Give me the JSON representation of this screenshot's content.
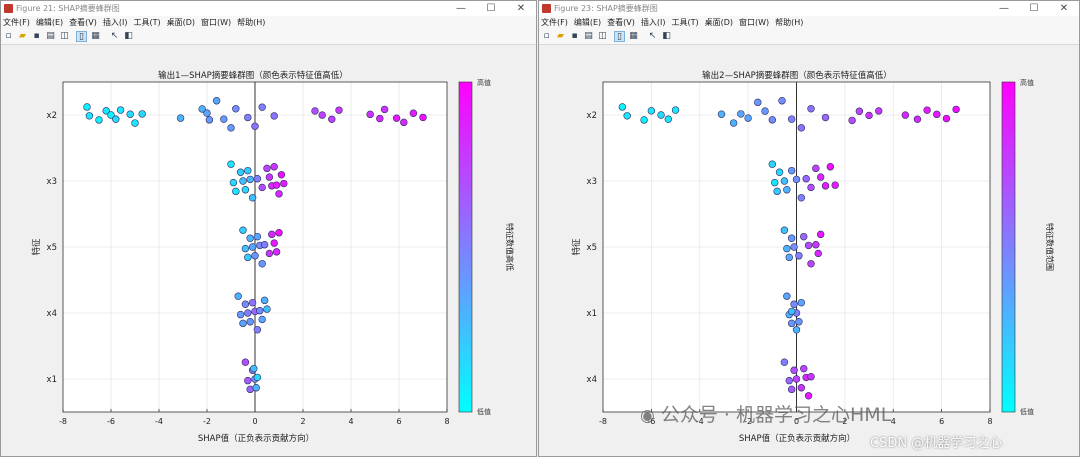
{
  "windows": [
    {
      "title": "Figure 21: SHAP摘要蜂群图",
      "menu": [
        "文件(F)",
        "编辑(E)",
        "查看(V)",
        "插入(I)",
        "工具(T)",
        "桌面(D)",
        "窗口(W)",
        "帮助(H)"
      ],
      "plot": {
        "title": "输出1—SHAP摘要蜂群图（颜色表示特征值高低）",
        "xlabel": "SHAP值（正负表示贡献方向）",
        "ylabel": "特征",
        "colorbar": {
          "top_label": "高值",
          "bottom_label": "低值",
          "label": "特征数值高低"
        }
      }
    },
    {
      "title": "Figure 23: SHAP摘要蜂群图",
      "menu": [
        "文件(F)",
        "编辑(E)",
        "查看(V)",
        "插入(I)",
        "工具(T)",
        "桌面(D)",
        "窗口(W)",
        "帮助(H)"
      ],
      "plot": {
        "title": "输出2—SHAP摘要蜂群图（颜色表示特征值高低）",
        "xlabel": "SHAP值（正负表示贡献方向）",
        "ylabel": "特征",
        "colorbar": {
          "top_label": "高值",
          "bottom_label": "低值",
          "label": "特征数值范围"
        }
      }
    }
  ],
  "toolbar_icons": [
    "new-file-icon",
    "open-folder-icon",
    "save-icon",
    "print-icon",
    "print-preview-icon",
    "link-plot-icon",
    "data-cursor-icon",
    "arrow-icon",
    "panel-icon"
  ],
  "watermark": {
    "wechat": "公众号 · 机器学习之心HML",
    "csdn": "CSDN @机器学习之心"
  },
  "colors": {
    "colormap_low": "#00ffff",
    "colormap_high": "#ff00ff"
  },
  "chart_data": [
    {
      "type": "scatter",
      "subtype": "beeswarm",
      "title": "输出1—SHAP摘要蜂群图（颜色表示特征值高低）",
      "xlabel": "SHAP值（正负表示贡献方向）",
      "ylabel": "特征",
      "xlim": [
        -8,
        8
      ],
      "xticks": [
        -8,
        -6,
        -4,
        -2,
        0,
        2,
        4,
        6,
        8
      ],
      "grid": true,
      "colormap": "cool",
      "features": [
        {
          "name": "x2",
          "points": [
            [
              -7,
              0.05
            ],
            [
              -6.9,
              0.1
            ],
            [
              -6.5,
              0.05
            ],
            [
              -6.2,
              0.1
            ],
            [
              -6,
              0.05
            ],
            [
              -5.8,
              0.15
            ],
            [
              -5.6,
              0.1
            ],
            [
              -5.2,
              0.15
            ],
            [
              -5,
              0.1
            ],
            [
              -4.7,
              0.15
            ],
            [
              -3.1,
              0.3
            ],
            [
              -2.2,
              0.3
            ],
            [
              -2,
              0.35
            ],
            [
              -1.9,
              0.4
            ],
            [
              -1.6,
              0.35
            ],
            [
              -1.3,
              0.4
            ],
            [
              -1,
              0.4
            ],
            [
              -0.8,
              0.45
            ],
            [
              -0.3,
              0.5
            ],
            [
              0,
              0.55
            ],
            [
              0.3,
              0.5
            ],
            [
              0.8,
              0.55
            ],
            [
              2.5,
              0.7
            ],
            [
              2.8,
              0.75
            ],
            [
              3.2,
              0.75
            ],
            [
              3.5,
              0.8
            ],
            [
              4.8,
              0.8
            ],
            [
              5.2,
              0.85
            ],
            [
              5.4,
              0.8
            ],
            [
              5.9,
              0.9
            ],
            [
              6.2,
              0.85
            ],
            [
              6.6,
              0.9
            ],
            [
              7,
              0.95
            ]
          ]
        },
        {
          "name": "x3",
          "points": [
            [
              -1,
              0.1
            ],
            [
              -0.9,
              0.15
            ],
            [
              -0.8,
              0.1
            ],
            [
              -0.6,
              0.2
            ],
            [
              -0.5,
              0.25
            ],
            [
              -0.4,
              0.15
            ],
            [
              -0.3,
              0.2
            ],
            [
              -0.2,
              0.3
            ],
            [
              -0.1,
              0.25
            ],
            [
              0.1,
              0.5
            ],
            [
              0.3,
              0.7
            ],
            [
              0.5,
              0.75
            ],
            [
              0.6,
              0.8
            ],
            [
              0.7,
              0.85
            ],
            [
              0.8,
              0.8
            ],
            [
              0.9,
              0.9
            ],
            [
              1,
              0.85
            ],
            [
              1.1,
              0.95
            ],
            [
              1.2,
              0.9
            ]
          ]
        },
        {
          "name": "x5",
          "points": [
            [
              -0.5,
              0.2
            ],
            [
              -0.4,
              0.25
            ],
            [
              -0.3,
              0.2
            ],
            [
              -0.2,
              0.3
            ],
            [
              -0.1,
              0.35
            ],
            [
              0,
              0.4
            ],
            [
              0.1,
              0.35
            ],
            [
              0.2,
              0.45
            ],
            [
              0.3,
              0.4
            ],
            [
              0.4,
              0.5
            ],
            [
              0.6,
              0.8
            ],
            [
              0.7,
              0.85
            ],
            [
              0.8,
              0.9
            ],
            [
              0.9,
              0.85
            ],
            [
              1,
              0.95
            ]
          ]
        },
        {
          "name": "x4",
          "points": [
            [
              -0.7,
              0.3
            ],
            [
              -0.6,
              0.4
            ],
            [
              -0.5,
              0.35
            ],
            [
              -0.4,
              0.45
            ],
            [
              -0.3,
              0.5
            ],
            [
              -0.2,
              0.4
            ],
            [
              -0.1,
              0.55
            ],
            [
              0,
              0.6
            ],
            [
              0.1,
              0.5
            ],
            [
              0.2,
              0.45
            ],
            [
              0.3,
              0.35
            ],
            [
              0.4,
              0.3
            ],
            [
              0.5,
              0.25
            ]
          ]
        },
        {
          "name": "x1",
          "points": [
            [
              -0.4,
              0.7
            ],
            [
              -0.3,
              0.65
            ],
            [
              -0.2,
              0.6
            ],
            [
              -0.1,
              0.5
            ],
            [
              0,
              0.45
            ],
            [
              0.05,
              0.3
            ],
            [
              -0.05,
              0.25
            ],
            [
              0.1,
              0.15
            ]
          ]
        }
      ]
    },
    {
      "type": "scatter",
      "subtype": "beeswarm",
      "title": "输出2—SHAP摘要蜂群图（颜色表示特征值高低）",
      "xlabel": "SHAP值（正负表示贡献方向）",
      "ylabel": "特征",
      "xlim": [
        -8,
        8
      ],
      "xticks": [
        -8,
        -6,
        -4,
        -2,
        0,
        2,
        4,
        6,
        8
      ],
      "grid": true,
      "colormap": "cool",
      "features": [
        {
          "name": "x2",
          "points": [
            [
              -7.2,
              0.05
            ],
            [
              -7,
              0.1
            ],
            [
              -6.3,
              0.05
            ],
            [
              -6,
              0.1
            ],
            [
              -5.6,
              0.15
            ],
            [
              -5.3,
              0.1
            ],
            [
              -5,
              0.1
            ],
            [
              -3.1,
              0.3
            ],
            [
              -2.6,
              0.3
            ],
            [
              -2.3,
              0.35
            ],
            [
              -2,
              0.35
            ],
            [
              -1.6,
              0.4
            ],
            [
              -1.3,
              0.4
            ],
            [
              -1,
              0.45
            ],
            [
              -0.6,
              0.45
            ],
            [
              -0.2,
              0.5
            ],
            [
              0.2,
              0.55
            ],
            [
              0.6,
              0.55
            ],
            [
              1.2,
              0.6
            ],
            [
              2.3,
              0.7
            ],
            [
              2.6,
              0.75
            ],
            [
              3,
              0.8
            ],
            [
              3.4,
              0.8
            ],
            [
              4.5,
              0.85
            ],
            [
              5,
              0.85
            ],
            [
              5.4,
              0.9
            ],
            [
              5.8,
              0.9
            ],
            [
              6.2,
              0.95
            ],
            [
              6.6,
              0.95
            ]
          ]
        },
        {
          "name": "x3",
          "points": [
            [
              -1,
              0.15
            ],
            [
              -0.9,
              0.1
            ],
            [
              -0.8,
              0.2
            ],
            [
              -0.7,
              0.15
            ],
            [
              -0.5,
              0.25
            ],
            [
              -0.4,
              0.3
            ],
            [
              -0.2,
              0.4
            ],
            [
              0,
              0.45
            ],
            [
              0.2,
              0.5
            ],
            [
              0.4,
              0.6
            ],
            [
              0.6,
              0.7
            ],
            [
              0.8,
              0.75
            ],
            [
              1,
              0.85
            ],
            [
              1.2,
              0.9
            ],
            [
              1.4,
              0.95
            ],
            [
              1.6,
              0.9
            ]
          ]
        },
        {
          "name": "x5",
          "points": [
            [
              -0.5,
              0.25
            ],
            [
              -0.4,
              0.3
            ],
            [
              -0.3,
              0.35
            ],
            [
              -0.2,
              0.4
            ],
            [
              -0.1,
              0.45
            ],
            [
              0.1,
              0.5
            ],
            [
              0.3,
              0.6
            ],
            [
              0.5,
              0.7
            ],
            [
              0.6,
              0.75
            ],
            [
              0.8,
              0.8
            ],
            [
              0.9,
              0.85
            ],
            [
              1,
              0.9
            ]
          ]
        },
        {
          "name": "x1",
          "points": [
            [
              -0.4,
              0.35
            ],
            [
              -0.3,
              0.3
            ],
            [
              -0.2,
              0.4
            ],
            [
              -0.1,
              0.45
            ],
            [
              0,
              0.5
            ],
            [
              0.1,
              0.4
            ],
            [
              0.2,
              0.35
            ],
            [
              -0.2,
              0.25
            ],
            [
              0,
              0.3
            ]
          ]
        },
        {
          "name": "x4",
          "points": [
            [
              -0.5,
              0.5
            ],
            [
              -0.3,
              0.6
            ],
            [
              -0.2,
              0.65
            ],
            [
              -0.1,
              0.7
            ],
            [
              0,
              0.75
            ],
            [
              0.2,
              0.8
            ],
            [
              0.3,
              0.75
            ],
            [
              0.4,
              0.85
            ],
            [
              0.5,
              0.9
            ],
            [
              0.6,
              0.8
            ]
          ]
        }
      ]
    }
  ]
}
